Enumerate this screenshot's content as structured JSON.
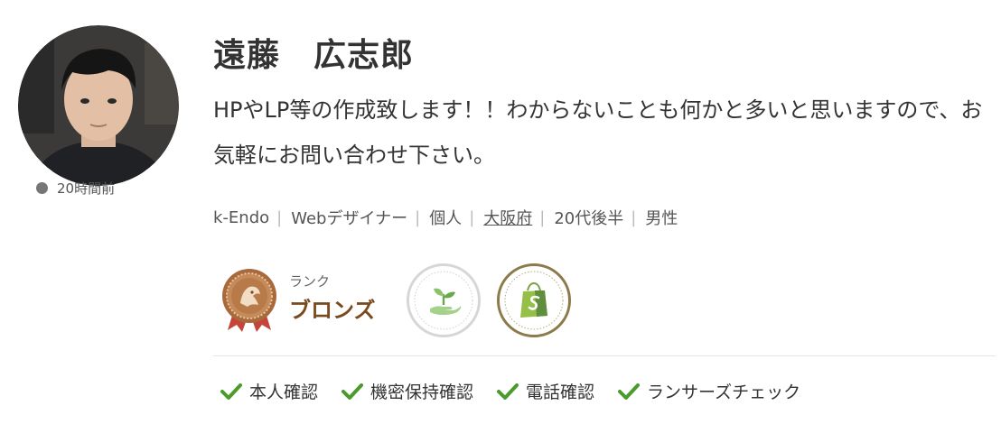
{
  "profile": {
    "name": "遠藤　広志郎",
    "bio": "HPやLP等の作成致します！！わからないことも何かと多いと思いますので、お気軽にお問い合わせ下さい。",
    "last_active": "20時間前"
  },
  "meta": {
    "username": "k-Endo",
    "occupation": "Webデザイナー",
    "type": "個人",
    "location": "大阪府",
    "age": "20代後半",
    "gender": "男性",
    "separator": "|"
  },
  "rank": {
    "label": "ランク",
    "value": "ブロンズ"
  },
  "badges": [
    {
      "icon": "sprout-hand-icon",
      "color": "#8cc26a"
    },
    {
      "icon": "shopify-bag-icon",
      "color": "#8d7a4a"
    }
  ],
  "verifications": [
    {
      "label": "本人確認"
    },
    {
      "label": "機密保持確認"
    },
    {
      "label": "電話確認"
    },
    {
      "label": "ランサーズチェック"
    }
  ],
  "colors": {
    "accent_green": "#4a9a2c",
    "bronze": "#7a4a1e",
    "text": "#333333",
    "muted": "#555555"
  }
}
